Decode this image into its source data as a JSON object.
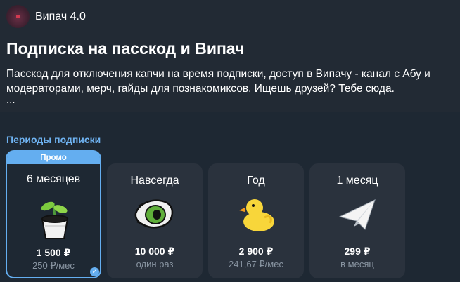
{
  "channel": {
    "name": "Випач 4.0"
  },
  "header": {
    "title": "Подписка на пасскод и Випач",
    "description": "Пасскод для отключения капчи на время подписки, доступ в Випачу - канал с Абу и модераторами, мерч, гайды для познакомиксов. Ищешь друзей? Тебе сюда.",
    "more": "..."
  },
  "periods": {
    "label": "Периоды подписки",
    "plans": [
      {
        "name": "6 месяцев",
        "badge": "Промо",
        "price": "1 500 ₽",
        "sub": "250 ₽/мес",
        "icon": "sprout-pot-icon",
        "selected": true
      },
      {
        "name": "Навсегда",
        "price": "10 000 ₽",
        "sub": "один раз",
        "icon": "eye-icon"
      },
      {
        "name": "Год",
        "price": "2 900 ₽",
        "sub": "241,67 ₽/мес",
        "icon": "duck-icon"
      },
      {
        "name": "1 месяц",
        "price": "299 ₽",
        "sub": "в месяц",
        "icon": "paper-plane-icon"
      }
    ]
  },
  "colors": {
    "accent": "#64aef0",
    "background": "#1e2833",
    "card": "#2a323d"
  }
}
